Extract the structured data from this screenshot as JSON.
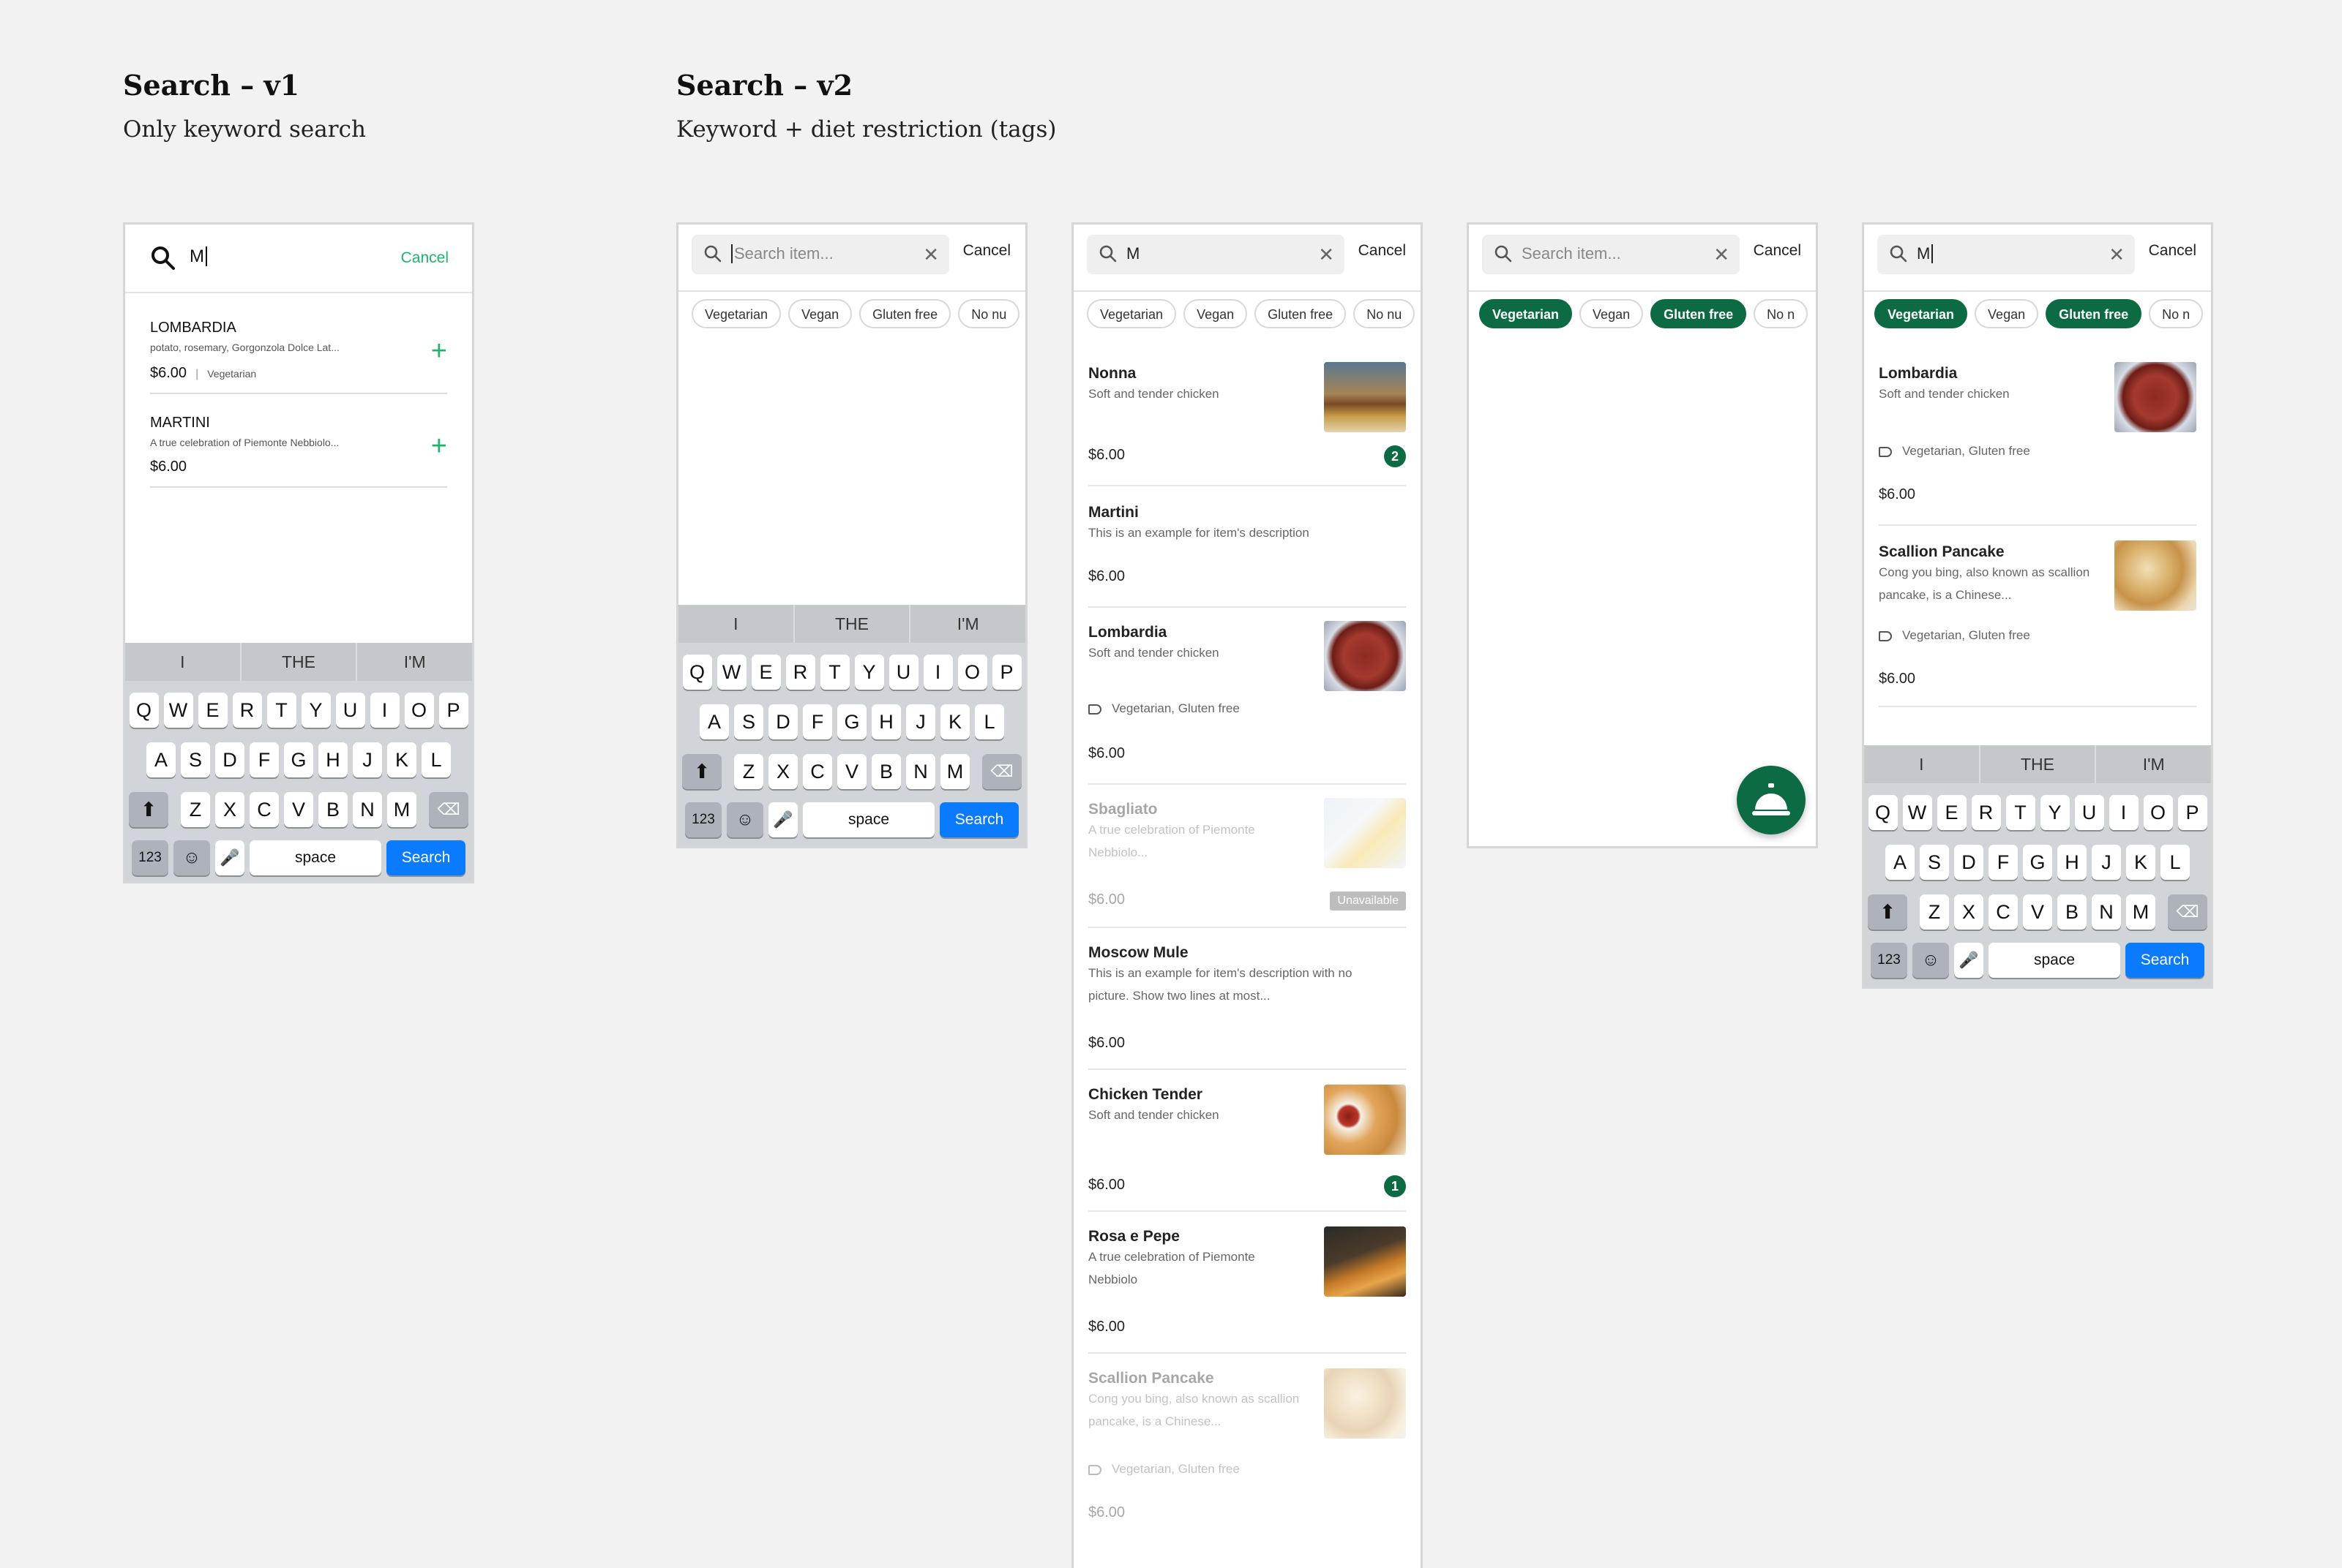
{
  "v1": {
    "title": "Search – v1",
    "subtitle": "Only keyword search",
    "search_value": "M",
    "cancel_label": "Cancel",
    "items": [
      {
        "name": "LOMBARDIA",
        "desc": "potato, rosemary, Gorgonzola Dolce Lat...",
        "price": "$6.00",
        "sep": "|",
        "tag": "Vegetarian"
      },
      {
        "name": "MARTINI",
        "desc": "A true celebration of Piemonte Nebbiolo...",
        "price": "$6.00"
      }
    ]
  },
  "v2": {
    "title": "Search – v2",
    "subtitle": "Keyword + diet restriction (tags)",
    "search_placeholder": "Search item...",
    "search_value": "M",
    "cancel_label": "Cancel",
    "chips": [
      "Vegetarian",
      "Vegan",
      "Gluten free",
      "No nu",
      "No n"
    ],
    "results": [
      {
        "name": "Nonna",
        "desc": "Soft and tender chicken",
        "price": "$6.00",
        "badge": "2"
      },
      {
        "name": "Martini",
        "desc": "This is an example for item's description",
        "price": "$6.00"
      },
      {
        "name": "Lombardia",
        "desc": "Soft and tender chicken",
        "tags": "Vegetarian, Gluten free",
        "price": "$6.00"
      },
      {
        "name": "Sbagliato",
        "desc": "A true celebration of Piemonte Nebbiolo...",
        "price": "$6.00",
        "status": "Unavailable"
      },
      {
        "name": "Moscow Mule",
        "desc": "This is an example for item's description with no picture. Show two lines at most...",
        "price": "$6.00"
      },
      {
        "name": "Chicken Tender",
        "desc": "Soft and tender chicken",
        "price": "$6.00",
        "badge": "1"
      },
      {
        "name": "Rosa e Pepe",
        "desc": "A true celebration of Piemonte Nebbiolo",
        "price": "$6.00"
      },
      {
        "name": "Scallion Pancake",
        "desc": "Cong you bing, also known as scallion pancake, is a Chinese...",
        "tags": "Vegetarian, Gluten free",
        "price": "$6.00"
      }
    ],
    "filtered_results": [
      {
        "name": "Lombardia",
        "desc": "Soft and tender chicken",
        "tags": "Vegetarian, Gluten free",
        "price": "$6.00"
      },
      {
        "name": "Scallion Pancake",
        "desc": "Cong you bing, also known as scallion pancake, is a Chinese...",
        "tags": "Vegetarian, Gluten free",
        "price": "$6.00"
      }
    ]
  },
  "keyboard": {
    "suggestions": [
      "I",
      "THE",
      "I'M"
    ],
    "row1": [
      "Q",
      "W",
      "E",
      "R",
      "T",
      "Y",
      "U",
      "I",
      "O",
      "P"
    ],
    "row2": [
      "A",
      "S",
      "D",
      "F",
      "G",
      "H",
      "J",
      "K",
      "L"
    ],
    "row3": [
      "Z",
      "X",
      "C",
      "V",
      "B",
      "N",
      "M"
    ],
    "numbers_key": "123",
    "space_key": "space",
    "search_key": "Search"
  },
  "colors": {
    "brand_green": "#0c6b43",
    "accent_green": "#20b46a",
    "ios_blue": "#0a7bff"
  }
}
